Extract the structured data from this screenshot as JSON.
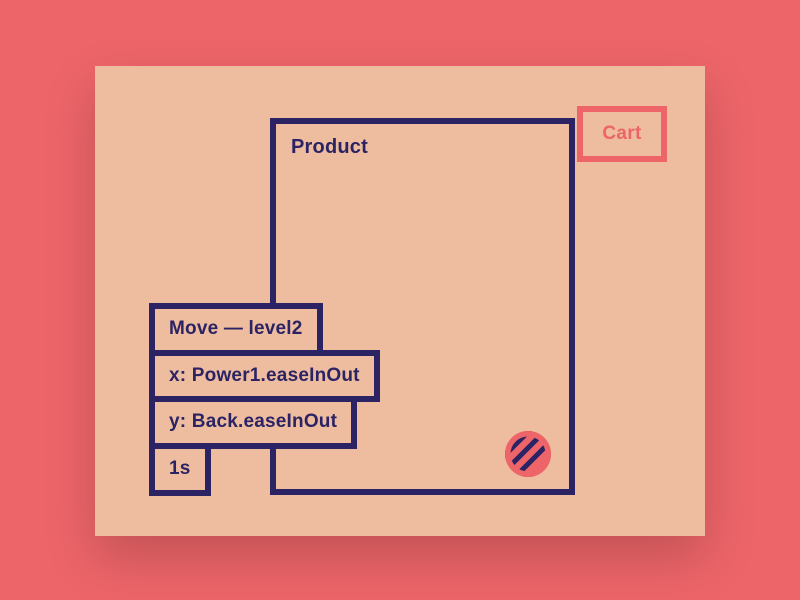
{
  "colors": {
    "background": "#ed6569",
    "card": "#eebd9f",
    "stroke": "#2c2364",
    "accent": "#ed6569"
  },
  "product": {
    "label": "Product"
  },
  "cart": {
    "label": "Cart"
  },
  "animation": {
    "title": "Move — level2",
    "x_easing": "x: Power1.easeInOut",
    "y_easing": "y: Back.easeInOut",
    "duration": "1s"
  }
}
